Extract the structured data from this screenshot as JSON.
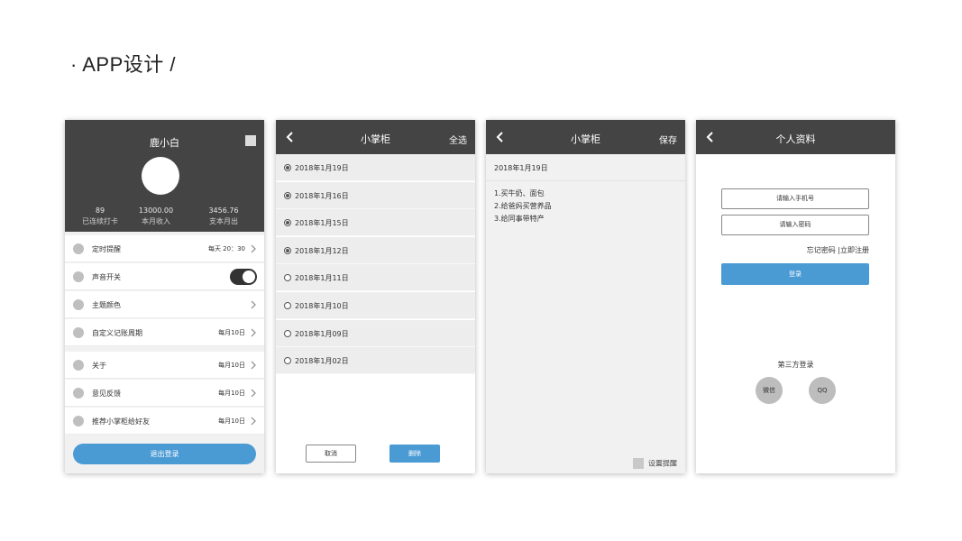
{
  "page": {
    "title": "· APP设计 /"
  },
  "profile": {
    "name": "鹿小白",
    "stats": [
      {
        "value": "89",
        "label": "已连续打卡"
      },
      {
        "value": "13000.00",
        "label": "本月收入"
      },
      {
        "value": "3456.76",
        "label": "支本月出"
      }
    ],
    "items": [
      {
        "label": "定时提醒",
        "value": "每天 20：30"
      },
      {
        "label": "声音开关",
        "value": ""
      },
      {
        "label": "主题颜色",
        "value": ""
      },
      {
        "label": "自定义记账周期",
        "value": "每月10日"
      },
      {
        "label": "关于",
        "value": "每月10日"
      },
      {
        "label": "意见反馈",
        "value": "每月10日"
      },
      {
        "label": "推荐小掌柜给好友",
        "value": "每月10日"
      }
    ],
    "sound_toggle_on": true,
    "logout_label": "退出登录"
  },
  "list_screen": {
    "title": "小掌柜",
    "select_all": "全选",
    "dates": [
      {
        "date": "2018年1月19日",
        "checked": true
      },
      {
        "date": "2018年1月16日",
        "checked": true
      },
      {
        "date": "2018年1月15日",
        "checked": true
      },
      {
        "date": "2018年1月12日",
        "checked": true
      },
      {
        "date": "2018年1月11日",
        "checked": false
      },
      {
        "date": "2018年1月10日",
        "checked": false
      },
      {
        "date": "2018年1月09日",
        "checked": false
      },
      {
        "date": "2018年1月02日",
        "checked": false
      }
    ],
    "cancel_label": "取消",
    "delete_label": "删除"
  },
  "note_screen": {
    "title": "小掌柜",
    "save": "保存",
    "date": "2018年1月19日",
    "lines": [
      "1.买牛奶、面包",
      "2.给爸妈买营养品",
      "3.给同事带特产"
    ],
    "remind_label": "设置提醒"
  },
  "login_screen": {
    "title": "个人资料",
    "phone_placeholder": "请输入手机号",
    "password_placeholder": "请输入密码",
    "forgot": "忘记密码",
    "register": "|立即注册",
    "login_label": "登录",
    "third_party": "第三方登录",
    "wechat": "微信",
    "qq": "QQ"
  },
  "colors": {
    "header": "#444444",
    "accent": "#4a9ad4"
  },
  "icons": {
    "back": "chevron-left-icon",
    "chevron": "chevron-right-icon"
  }
}
